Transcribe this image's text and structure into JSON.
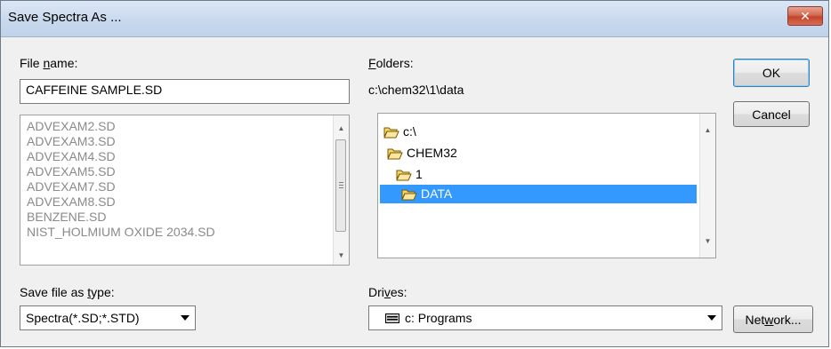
{
  "window": {
    "title": "Save Spectra As ...",
    "close_glyph": "✕"
  },
  "file_name": {
    "label_pre": "File ",
    "label_mnemonic": "n",
    "label_post": "ame:",
    "value": "CAFFEINE SAMPLE.SD"
  },
  "file_list": [
    "ADVEXAM2.SD",
    "ADVEXAM3.SD",
    "ADVEXAM4.SD",
    "ADVEXAM5.SD",
    "ADVEXAM7.SD",
    "ADVEXAM8.SD",
    "BENZENE.SD",
    "NIST_HOLMIUM OXIDE 2034.SD"
  ],
  "folders": {
    "label_mnemonic": "F",
    "label_post": "olders:",
    "current_path": "c:\\chem32\\1\\data",
    "tree": [
      "c:\\",
      "CHEM32",
      "1",
      "DATA"
    ],
    "selected_index": 3
  },
  "save_type": {
    "label_pre": "Save file as ",
    "label_mnemonic": "t",
    "label_post": "ype:",
    "value": "Spectra(*.SD;*.STD)"
  },
  "drives": {
    "label_pre": "Dri",
    "label_mnemonic": "v",
    "label_post": "es:",
    "value": "c: Programs"
  },
  "buttons": {
    "ok": "OK",
    "cancel": "Cancel",
    "network_pre": "Net",
    "network_mnemonic": "w",
    "network_post": "ork..."
  },
  "colors": {
    "selection": "#3399ff",
    "folder_fill": "#f5d36b",
    "disabled_text": "#8a8a8a"
  },
  "icons": {
    "folder": "open-folder-icon",
    "drive": "hard-drive-icon"
  }
}
